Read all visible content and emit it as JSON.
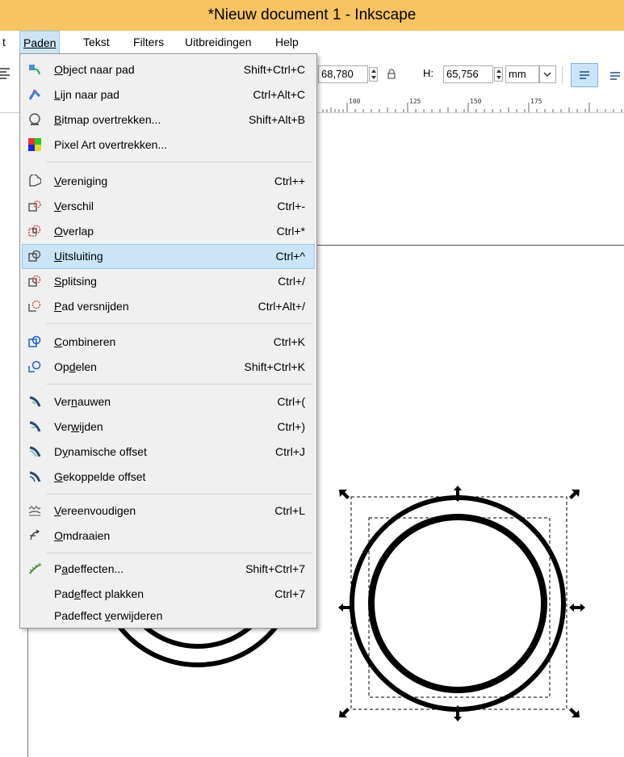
{
  "window": {
    "title": "*Nieuw document 1 - Inkscape"
  },
  "menubar": {
    "items": [
      {
        "label": "t",
        "key": "edit-partial"
      },
      {
        "label": "Paden",
        "key": "paden"
      },
      {
        "label": "Tekst",
        "key": "tekst"
      },
      {
        "label": "Filters",
        "key": "filters"
      },
      {
        "label": "Uitbreidingen",
        "key": "uitbreidingen"
      },
      {
        "label": "Help",
        "key": "help"
      }
    ]
  },
  "toolbar": {
    "w_value": "68,780",
    "h_label": "H:",
    "h_value": "65,756",
    "unit": "mm"
  },
  "ruler": {
    "labels": [
      "100",
      "125",
      "150",
      "175"
    ]
  },
  "menu": {
    "sections": [
      [
        {
          "label": "Object naar pad",
          "u": "O",
          "shortcut": "Shift+Ctrl+C",
          "icon": "object-to-path-icon"
        },
        {
          "label": "Lijn naar pad",
          "u": "L",
          "shortcut": "Ctrl+Alt+C",
          "icon": "stroke-to-path-icon"
        },
        {
          "label": "Bitmap overtrekken...",
          "u": "B",
          "shortcut": "Shift+Alt+B",
          "icon": "trace-bitmap-icon"
        },
        {
          "label": "Pixel Art overtrekken...",
          "u": "",
          "shortcut": "",
          "icon": "trace-pixel-art-icon"
        }
      ],
      [
        {
          "label": "Vereniging",
          "u": "V",
          "shortcut": "Ctrl++",
          "icon": "union-icon"
        },
        {
          "label": "Verschil",
          "u": "V",
          "shortcut": "Ctrl+-",
          "icon": "difference-icon"
        },
        {
          "label": "Overlap",
          "u": "O",
          "shortcut": "Ctrl+*",
          "icon": "intersection-icon"
        },
        {
          "label": "Uitsluiting",
          "u": "U",
          "shortcut": "Ctrl+^",
          "icon": "exclusion-icon",
          "highlighted": true
        },
        {
          "label": "Splitsing",
          "u": "S",
          "shortcut": "Ctrl+/",
          "icon": "division-icon"
        },
        {
          "label": "Pad versnijden",
          "u": "P",
          "shortcut": "Ctrl+Alt+/",
          "icon": "cut-path-icon"
        }
      ],
      [
        {
          "label": "Combineren",
          "u": "C",
          "shortcut": "Ctrl+K",
          "icon": "combine-icon"
        },
        {
          "label": "Opdelen",
          "u": "d",
          "shortcut": "Shift+Ctrl+K",
          "icon": "break-apart-icon"
        }
      ],
      [
        {
          "label": "Vernauwen",
          "u": "n",
          "shortcut": "Ctrl+(",
          "icon": "inset-icon"
        },
        {
          "label": "Verwijden",
          "u": "w",
          "shortcut": "Ctrl+)",
          "icon": "outset-icon"
        },
        {
          "label": "Dynamische offset",
          "u": "y",
          "shortcut": "Ctrl+J",
          "icon": "dynamic-offset-icon"
        },
        {
          "label": "Gekoppelde offset",
          "u": "G",
          "shortcut": "",
          "icon": "linked-offset-icon"
        }
      ],
      [
        {
          "label": "Vereenvoudigen",
          "u": "V",
          "shortcut": "Ctrl+L",
          "icon": "simplify-icon"
        },
        {
          "label": "Omdraaien",
          "u": "O",
          "shortcut": "",
          "icon": "reverse-icon"
        }
      ],
      [
        {
          "label": "Padeffecten...",
          "u": "a",
          "shortcut": "Shift+Ctrl+7",
          "icon": "path-effects-icon"
        },
        {
          "label": "Padeffect plakken",
          "u": "e",
          "shortcut": "Ctrl+7",
          "icon": ""
        },
        {
          "label": "Padeffect verwijderen",
          "u": "v",
          "shortcut": "",
          "icon": ""
        }
      ]
    ]
  }
}
